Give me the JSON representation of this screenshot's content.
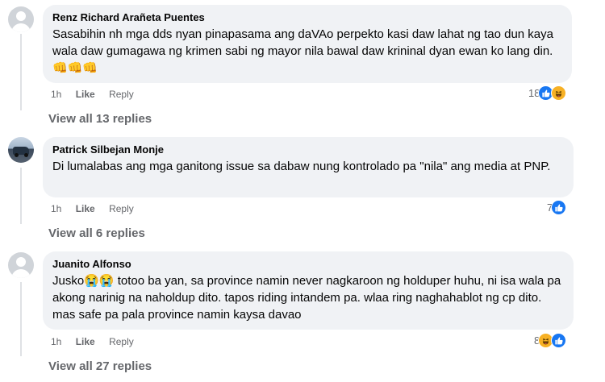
{
  "comments": [
    {
      "author": "Renz Richard Arañeta Puentes",
      "text": "Sasabihin nh mga dds nyan pinapasama ang daVAo perpekto kasi daw lahat ng tao dun kaya wala daw gumagawa ng krimen sabi ng mayor nila bawal daw krininal dyan ewan ko lang din.👊👊👊",
      "time": "1h",
      "like_label": "Like",
      "reply_label": "Reply",
      "reaction_count": "18",
      "reactions": [
        "like-icon",
        "haha-icon"
      ],
      "view_replies": "View all 13 replies"
    },
    {
      "author": "Patrick Silbejan Monje",
      "text": "Di lumalabas ang mga ganitong issue sa dabaw nung kontrolado pa \"nila\" ang media at PNP.",
      "time": "1h",
      "like_label": "Like",
      "reply_label": "Reply",
      "reaction_count": "7",
      "reactions": [
        "like-icon"
      ],
      "view_replies": "View all 6 replies"
    },
    {
      "author": "Juanito Alfonso",
      "text": "Jusko😭😭 totoo ba yan, sa province namin never nagkaroon ng holduper huhu, ni isa wala pa akong narinig na naholdup dito. tapos riding intandem pa. wlaa ring naghahablot ng cp dito. mas safe pa pala province namin kaysa davao",
      "time": "1h",
      "like_label": "Like",
      "reply_label": "Reply",
      "reaction_count": "8",
      "reactions": [
        "haha-icon",
        "like-icon"
      ],
      "view_replies": "View all 27 replies"
    }
  ]
}
